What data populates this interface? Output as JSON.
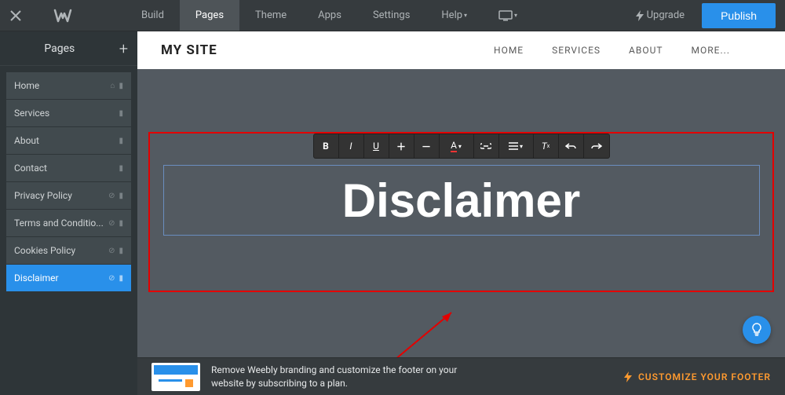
{
  "topnav": {
    "items": [
      "Build",
      "Pages",
      "Theme",
      "Apps",
      "Settings",
      "Help"
    ],
    "active_index": 1,
    "upgrade_label": "Upgrade",
    "publish_label": "Publish"
  },
  "sidebar": {
    "title": "Pages",
    "items": [
      {
        "label": "Home"
      },
      {
        "label": "Services"
      },
      {
        "label": "About"
      },
      {
        "label": "Contact"
      },
      {
        "label": "Privacy Policy"
      },
      {
        "label": "Terms and Conditio..."
      },
      {
        "label": "Cookies Policy"
      },
      {
        "label": "Disclaimer"
      }
    ],
    "active_index": 7
  },
  "site": {
    "title": "MY SITE",
    "nav": [
      "HOME",
      "SERVICES",
      "ABOUT",
      "MORE..."
    ]
  },
  "editor": {
    "heading_text": "Disclaimer",
    "toolbar": [
      "bold",
      "italic",
      "underline",
      "grow",
      "shrink",
      "color",
      "link",
      "align",
      "clearformat",
      "undo",
      "redo"
    ]
  },
  "footer": {
    "text_line1": "Remove Weebly branding and customize the footer on your",
    "text_line2": "website by subscribing to a plan.",
    "cta": "CUSTOMIZE YOUR FOOTER"
  }
}
